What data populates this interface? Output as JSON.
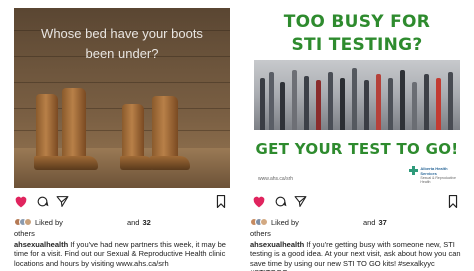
{
  "posts": [
    {
      "image_text": "Whose bed have your boots been under?",
      "liked_prefix": "Liked by",
      "liked_count": "32",
      "liked_suffix": "others",
      "liked_and": "and",
      "caption_user": "ahsexualhealth",
      "caption_text": "If you've had new partners this week, it may be time for a visit. Find out our Sexual & Reproductive Health clinic locations and hours by visiting www.ahs.ca/srh"
    },
    {
      "headline_top_1": "TOO BUSY FOR",
      "headline_top_2": "STI TESTING?",
      "headline_bottom": "GET YOUR TEST TO GO!",
      "image_url": "www.ahs.ca/srh",
      "logo_name_1": "Alberta Health",
      "logo_name_2": "Services",
      "logo_sub_1": "Sexual & Reproductive",
      "logo_sub_2": "Health",
      "liked_prefix": "Liked by",
      "liked_count": "37",
      "liked_suffix": "others",
      "liked_and": "and",
      "caption_user": "ahsexualhealth",
      "caption_text": "If you're getting busy with someone new, STI testing is a good idea. At your next visit, ask about how you can save time by using our new STI TO GO kits! #sexalkyyc #STITOGO"
    }
  ],
  "icons": [
    "heart-icon",
    "comment-icon",
    "share-icon",
    "bookmark-icon"
  ],
  "colors": {
    "like": "#e0245e",
    "headline_green": "#2e8b2e"
  }
}
